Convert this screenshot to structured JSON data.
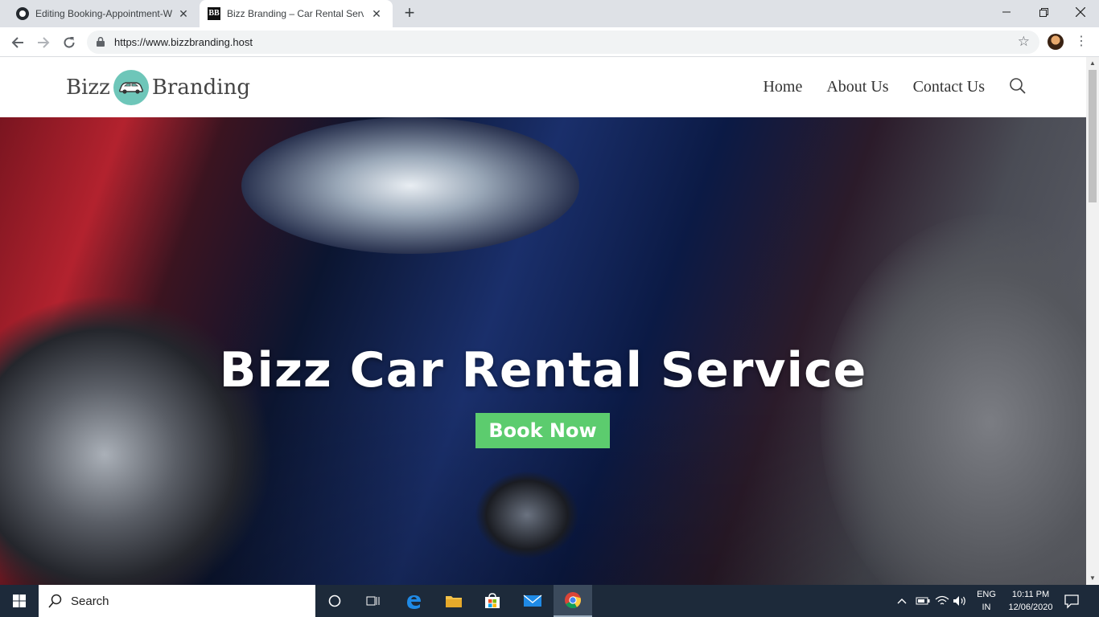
{
  "browser": {
    "tabs": [
      {
        "title": "Editing Booking-Appointment-W",
        "active": false,
        "icon": "github-icon"
      },
      {
        "title": "Bizz Branding – Car Rental Servic",
        "active": true,
        "icon": "bb-favicon"
      }
    ],
    "favicon_text": "BB",
    "url": "https://www.bizzbranding.host"
  },
  "site": {
    "logo": {
      "left": "Bizz",
      "right": "Branding",
      "mark_color": "#6ec6b9"
    },
    "nav": [
      "Home",
      "About Us",
      "Contact Us"
    ],
    "hero": {
      "title": "Bizz Car Rental Service",
      "button": "Book Now",
      "button_color": "#5ccc6e"
    }
  },
  "taskbar": {
    "search_label": "Search",
    "lang_line1": "ENG",
    "lang_line2": "IN",
    "time": "10:11 PM",
    "date": "12/06/2020"
  }
}
